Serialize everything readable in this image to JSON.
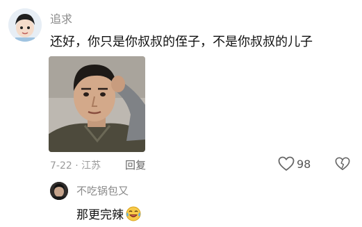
{
  "comment": {
    "username": "追求",
    "text": "还好，你只是你叔叔的侄子，不是你叔叔的儿子",
    "date": "7-22",
    "separator": "·",
    "location": "江苏",
    "reply_label": "回复",
    "like_count": "98",
    "avatar_icon": "child-avatar",
    "image_icon": "man-scratching-head-photo"
  },
  "reply": {
    "username": "不吃锅包又",
    "text": "那更完辣",
    "emoji_icon": "laughing-crying-emoji"
  }
}
